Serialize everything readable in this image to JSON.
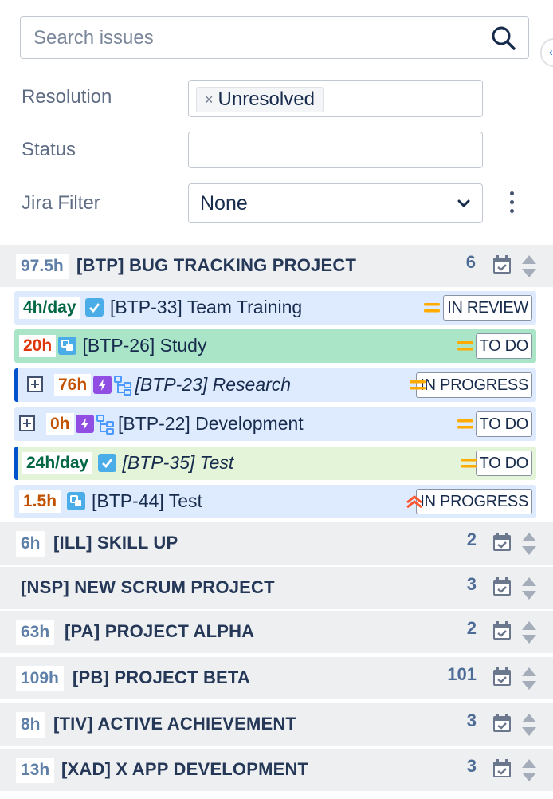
{
  "search": {
    "placeholder": "Search issues",
    "value": ""
  },
  "filters": {
    "resolution": {
      "label": "Resolution",
      "chip": "Unresolved",
      "chip_remove": "×"
    },
    "status": {
      "label": "Status",
      "value": ""
    },
    "jira_filter": {
      "label": "Jira Filter",
      "value": "None"
    }
  },
  "edge_handle_glyph": "‹",
  "projects": [
    {
      "hours": "97.5h",
      "name": "[BTP] BUG TRACKING PROJECT",
      "count": "6",
      "issues": [
        {
          "hours": "4h/day",
          "hours_color": "#006644",
          "type": "task",
          "key_title": "[BTP-33] Team Training",
          "priority": "medium",
          "status": "IN REVIEW",
          "bg": "blue"
        },
        {
          "hours": "20h",
          "hours_color": "#de350b",
          "type": "subtask",
          "key_title": "[BTP-26] Study",
          "priority": "medium",
          "status": "TO DO",
          "bg": "green"
        },
        {
          "hours": "76h",
          "hours_color": "#c25100",
          "type": "epic",
          "key_title": "[BTP-23] Research",
          "priority": "medium",
          "status": "IN PROGRESS",
          "bg": "blue",
          "expandable": true,
          "italic": true
        },
        {
          "hours": "0h",
          "hours_color": "#c25100",
          "type": "epic",
          "key_title": "[BTP-22] Development",
          "priority": "medium",
          "status": "TO DO",
          "bg": "blue",
          "expandable": true
        },
        {
          "hours": "24h/day",
          "hours_color": "#006644",
          "type": "task",
          "key_title": "[BTP-35] Test",
          "priority": "medium",
          "status": "TO DO",
          "bg": "lime",
          "italic": true
        },
        {
          "hours": "1.5h",
          "hours_color": "#c25100",
          "type": "subtask",
          "key_title": "[BTP-44] Test",
          "priority": "high",
          "status": "IN PROGRESS",
          "bg": "blue"
        }
      ]
    },
    {
      "hours": "6h",
      "name": "[ILL] SKILL UP",
      "count": "2"
    },
    {
      "hours": "",
      "name": "[NSP] NEW SCRUM PROJECT",
      "count": "3"
    },
    {
      "hours": "63h",
      "name": "[PA] PROJECT ALPHA",
      "count": "2"
    },
    {
      "hours": "109h",
      "name": "[PB] PROJECT BETA",
      "count": "101"
    },
    {
      "hours": "8h",
      "name": "[TIV] ACTIVE ACHIEVEMENT",
      "count": "3"
    },
    {
      "hours": "13h",
      "name": "[XAD] X APP DEVELOPMENT",
      "count": "3"
    }
  ],
  "icons": {
    "search": "search-icon",
    "calendar": "calendar-check-icon",
    "sort": "sort-icon",
    "expand": "expand-plus-icon",
    "hierarchy": "hierarchy-icon",
    "priority_medium": "priority-medium-icon",
    "priority_high": "priority-high-icon",
    "kebab": "more-options-icon",
    "chevron": "chevron-down-icon"
  },
  "colors": {
    "project_bg": "#eeeff1",
    "hours_text": "#5e7fa8",
    "accent_blue": "#0052cc",
    "priority_medium": "#ffab00",
    "priority_high": "#ff5630"
  }
}
